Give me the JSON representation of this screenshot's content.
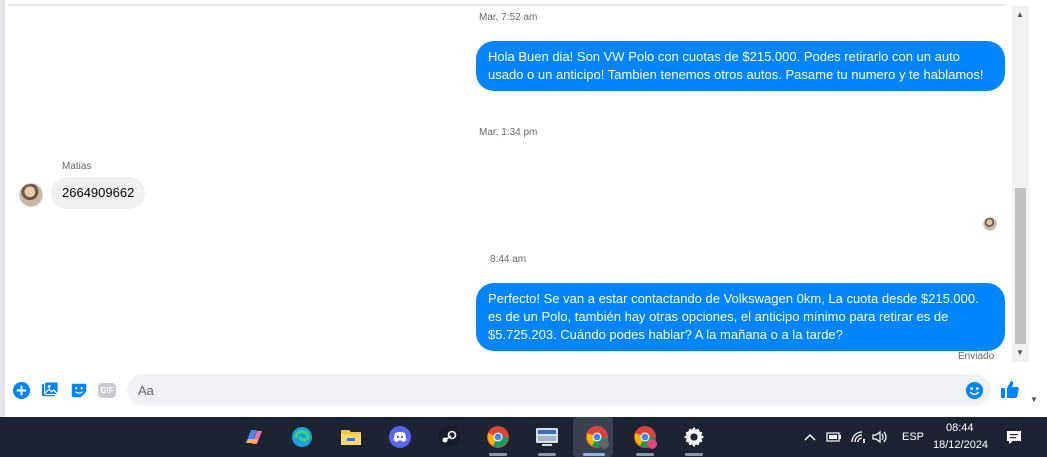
{
  "thread": {
    "timestamp_1": "Mar, 7:52 am",
    "message_1": "Hola Buen dia! Son VW Polo con cuotas de $215.000. Podes retirarlo con un auto usado o un anticipo! Tambien tenemos otros autos. Pasame tu numero y te hablamos!",
    "timestamp_2": "Mar, 1:34 pm",
    "sender_name": "Matias",
    "incoming_message": "2664909662",
    "timestamp_3": "8:44 am",
    "message_2": "Perfecto!  Se van a estar contactando de Volkswagen 0km, La cuota desde $215.000. es de un Polo, también hay otras opciones, el anticipo mínimo para retirar es de $5.725.203. Cuándo podes hablar? A la mañana o a la tarde?",
    "sent_status": "Enviado"
  },
  "composer": {
    "placeholder": "Aa",
    "gif_label": "GIF",
    "icons": [
      "plus-circle-icon",
      "image-icon",
      "sticker-icon",
      "gif-icon",
      "emoji-icon",
      "thumbs-up-icon"
    ]
  },
  "colors": {
    "accent": "#0084ff",
    "bubble_incoming": "#f0f0f0",
    "taskbar": "#1c2433"
  },
  "taskbar": {
    "apps": [
      "copilot-icon",
      "edge-icon",
      "file-explorer-icon",
      "discord-icon",
      "steam-icon",
      "chrome-icon",
      "network-app-icon",
      "chrome-active-icon",
      "chrome-profile-icon",
      "settings-icon"
    ],
    "language": "ESP",
    "time": "08:44",
    "date": "18/12/2024"
  }
}
